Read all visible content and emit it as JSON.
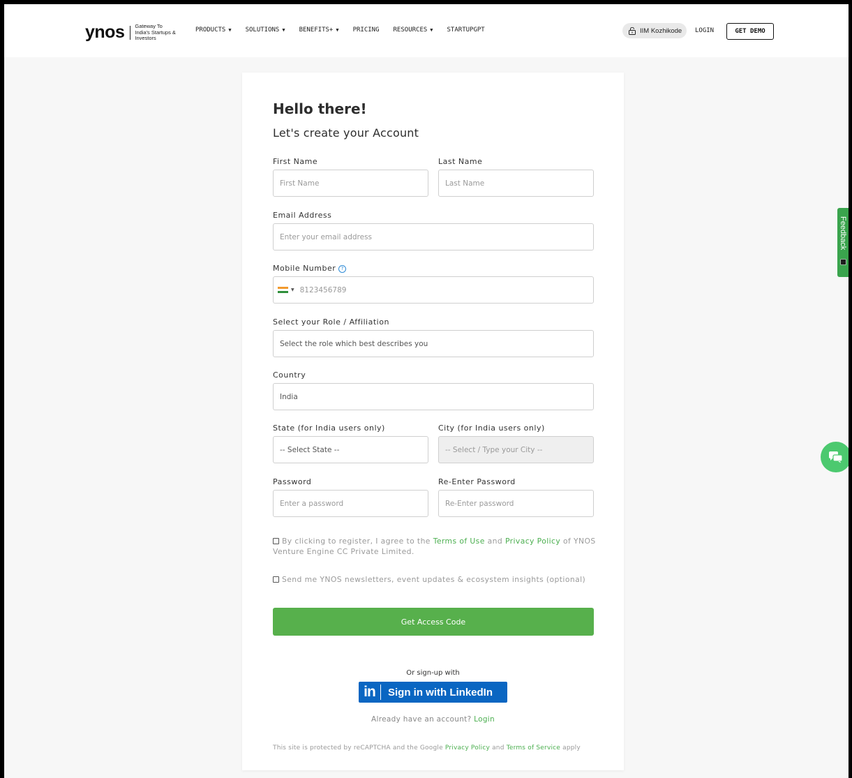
{
  "header": {
    "logo_text": "ynos",
    "tagline": "Gateway To India's Startups & Investors",
    "nav": [
      {
        "label": "PRODUCTS",
        "has_dropdown": true
      },
      {
        "label": "SOLUTIONS",
        "has_dropdown": true
      },
      {
        "label": "BENEFITS+",
        "has_dropdown": true
      },
      {
        "label": "PRICING",
        "has_dropdown": false
      },
      {
        "label": "RESOURCES",
        "has_dropdown": true
      },
      {
        "label": "STARTUPGPT",
        "has_dropdown": false
      }
    ],
    "institution": "IIM Kozhikode",
    "login": "LOGIN",
    "get_demo": "GET DEMO"
  },
  "form": {
    "heading": "Hello there!",
    "subheading": "Let's create your Account",
    "first_name": {
      "label": "First Name",
      "placeholder": "First Name"
    },
    "last_name": {
      "label": "Last Name",
      "placeholder": "Last Name"
    },
    "email": {
      "label": "Email Address",
      "placeholder": "Enter your email address"
    },
    "mobile": {
      "label": "Mobile Number",
      "placeholder": "8123456789",
      "help_icon": "?"
    },
    "role": {
      "label": "Select your Role / Affiliation",
      "placeholder": "Select the role which best describes you"
    },
    "country": {
      "label": "Country",
      "value": "India"
    },
    "state": {
      "label": "State (for India users only)",
      "placeholder": "-- Select State --"
    },
    "city": {
      "label": "City (for India users only)",
      "placeholder": "-- Select / Type your City --"
    },
    "password": {
      "label": "Password",
      "placeholder": "Enter a password"
    },
    "re_password": {
      "label": "Re-Enter Password",
      "placeholder": "Re-Enter password"
    },
    "terms": {
      "prefix": "By clicking to register, I agree to the",
      "terms_link": "Terms of Use",
      "and": "and",
      "privacy_link": "Privacy Policy",
      "suffix": "of YNOS Venture Engine CC Private Limited."
    },
    "newsletter": "Send me YNOS newsletters, event updates & ecosystem insights (optional)",
    "submit": "Get Access Code",
    "or_signup": "Or sign-up with",
    "linkedin_logo": "in",
    "linkedin": "Sign in with LinkedIn",
    "already": "Already have an account?",
    "login_link": "Login",
    "recaptcha": {
      "prefix": "This site is protected by reCAPTCHA and the Google",
      "privacy": "Privacy Policy",
      "and": "and",
      "terms": "Terms of Service",
      "suffix": "apply"
    }
  },
  "feedback_tab": "Feedback",
  "colors": {
    "accent": "#57b04c",
    "link": "#4caf50",
    "linkedin": "#0a66c2",
    "chat": "#4cc96f"
  }
}
